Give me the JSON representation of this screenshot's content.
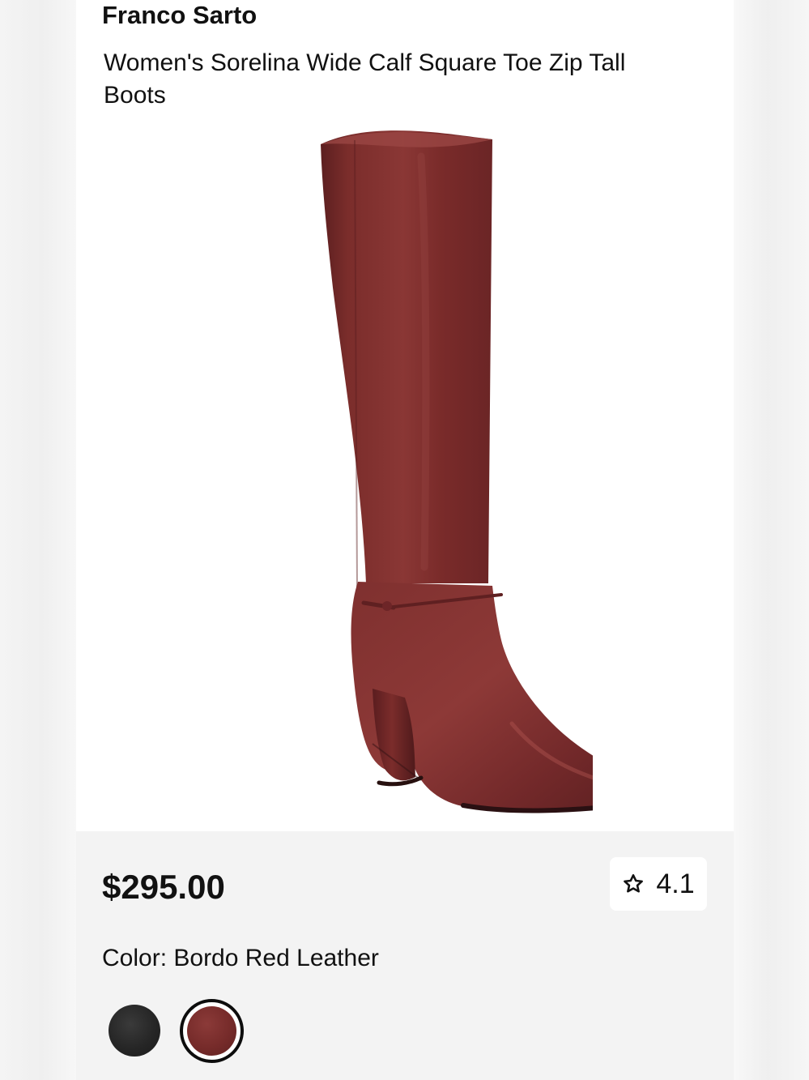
{
  "product": {
    "brand": "Franco Sarto",
    "title": "Women's Sorelina Wide Calf Square Toe Zip Tall Boots",
    "image_subject": "boot-image",
    "price": "$295.00",
    "rating": "4.1"
  },
  "color": {
    "label": "Color:",
    "selected": "Bordo Red Leather",
    "swatches": [
      {
        "name": "black",
        "hex": "#262626",
        "selected": false
      },
      {
        "name": "bordo-red",
        "hex": "#762b2a",
        "selected": true
      }
    ]
  },
  "icons": {
    "rating": "star-outline-icon"
  },
  "colors": {
    "boot": "#762b2a",
    "boot_dark": "#4f1b1c",
    "boot_light": "#9a4644",
    "page_background": "#f3f3f3",
    "image_background": "#ffffff"
  }
}
